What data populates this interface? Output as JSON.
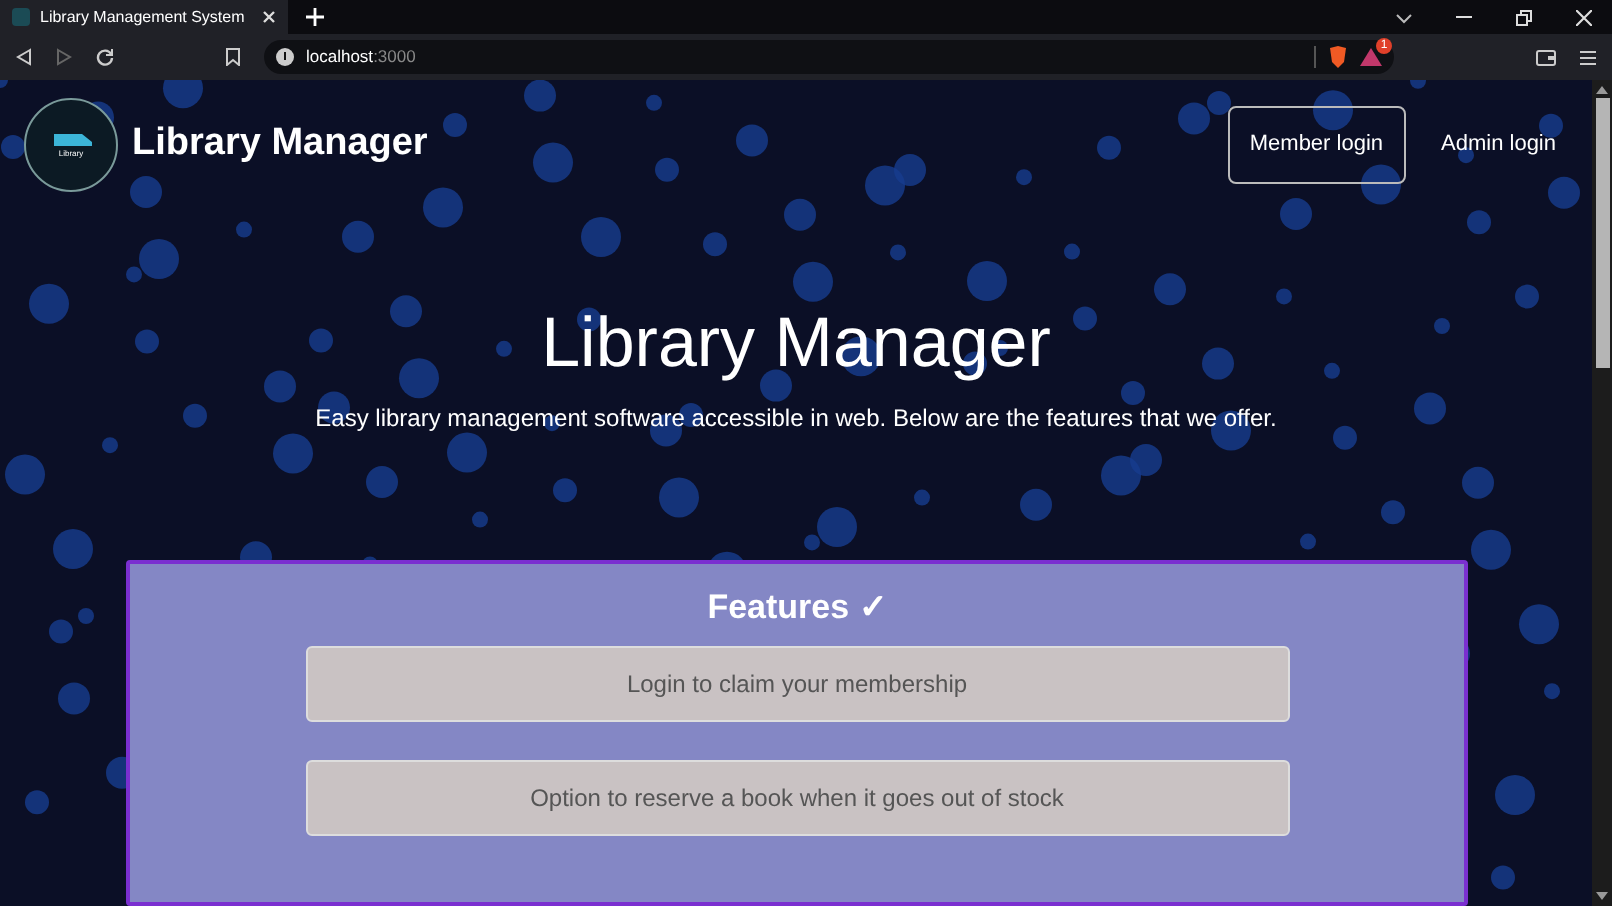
{
  "browser": {
    "tab_title": "Library Management System",
    "address": "localhost",
    "port": ":3000",
    "notification_count": "1"
  },
  "navbar": {
    "logo_text": "Library",
    "brand": "Library Manager",
    "links": [
      {
        "label": "Member login",
        "kind": "outlined"
      },
      {
        "label": "Admin login",
        "kind": "plain"
      }
    ]
  },
  "hero": {
    "title": "Library Manager",
    "subtitle": "Easy library management software accessible in web. Below are the features that we offer."
  },
  "features": {
    "heading": "Features ✓",
    "items": [
      "Login to claim your membership",
      "Option to reserve a book when it goes out of stock"
    ]
  }
}
